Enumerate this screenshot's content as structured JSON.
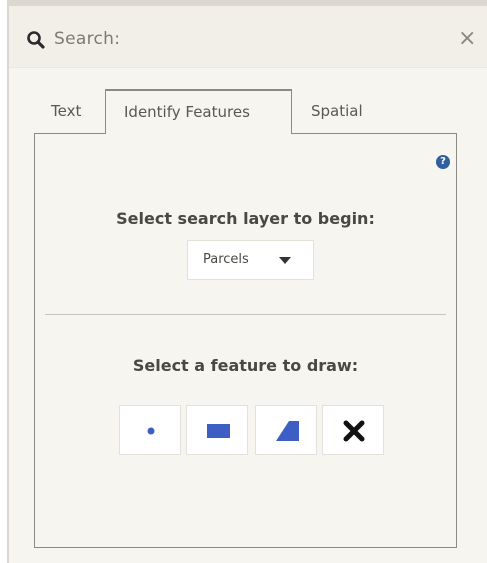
{
  "header": {
    "title": "Search:",
    "search_icon": "search-icon",
    "close_icon": "close-icon",
    "close_glyph": "×"
  },
  "tabs": [
    {
      "label": "Text",
      "active": false
    },
    {
      "label": "Identify Features",
      "active": true
    },
    {
      "label": "Spatial",
      "active": false
    }
  ],
  "content": {
    "help_glyph": "?",
    "layer_label": "Select search layer to begin:",
    "layer_select": {
      "selected": "Parcels"
    },
    "draw_label": "Select a feature to draw:",
    "tools": [
      {
        "name": "point",
        "icon": "point-icon"
      },
      {
        "name": "rectangle",
        "icon": "rectangle-icon"
      },
      {
        "name": "polygon",
        "icon": "polygon-icon"
      },
      {
        "name": "clear",
        "icon": "clear-icon"
      }
    ]
  },
  "colors": {
    "accent_blue": "#3d5fc4",
    "help_blue": "#2f5f9e",
    "panel_bg": "#f7f5ef",
    "header_bg": "#f2efe8"
  }
}
